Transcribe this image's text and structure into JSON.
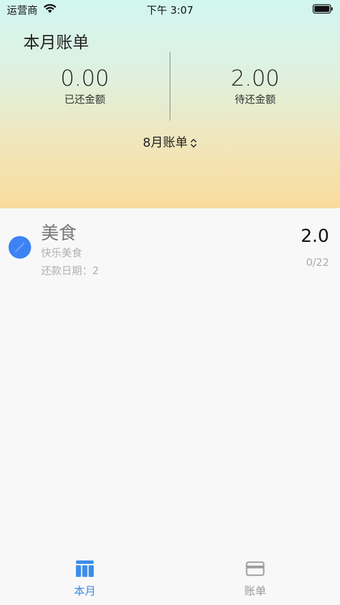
{
  "status_bar": {
    "carrier": "运营商",
    "time": "下午 3:07"
  },
  "header": {
    "title": "本月账单",
    "paid": {
      "value": "0.00",
      "label": "已还金额"
    },
    "pending": {
      "value": "2.00",
      "label": "待还金额"
    },
    "month_selector": "8月账单"
  },
  "bills": [
    {
      "title": "美食",
      "subtitle": "快乐美食",
      "date_label": "还款日期：",
      "date_value": "2",
      "amount": "2.0",
      "progress": "0/22",
      "dot_color": "#3d82f5"
    }
  ],
  "tabbar": {
    "tabs": [
      {
        "label": "本月",
        "icon": "calendar-table-icon",
        "active": true
      },
      {
        "label": "账单",
        "icon": "credit-card-icon",
        "active": false
      }
    ]
  },
  "colors": {
    "accent": "#3d8de9",
    "inactive": "#9b9b9b"
  }
}
